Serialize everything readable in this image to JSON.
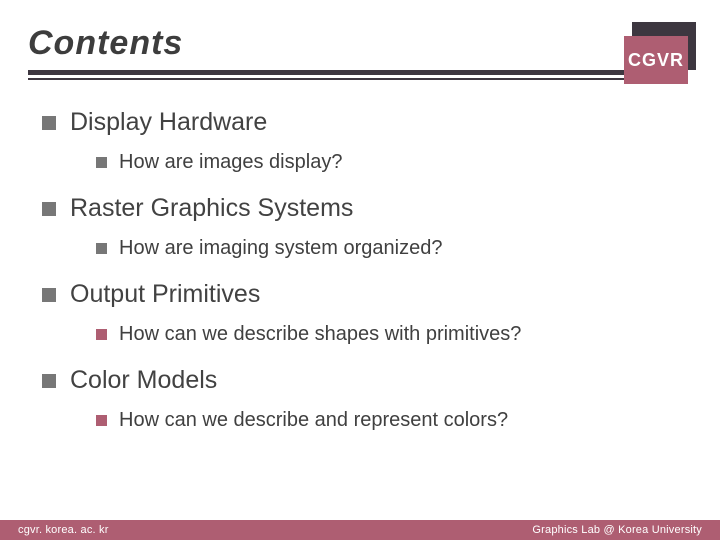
{
  "header": {
    "title": "Contents",
    "badge": "CGVR"
  },
  "items": [
    {
      "title": "Display Hardware",
      "sub": "How are images display?",
      "bullet_color": "#777777"
    },
    {
      "title": "Raster Graphics Systems",
      "sub": "How are imaging system organized?",
      "bullet_color": "#777777"
    },
    {
      "title": "Output Primitives",
      "sub": "How can we describe shapes with primitives?",
      "bullet_color": "#ae5e72"
    },
    {
      "title": "Color Models",
      "sub": "How can we describe and represent colors?",
      "bullet_color": "#ae5e72"
    }
  ],
  "footer": {
    "left": "cgvr. korea. ac. kr",
    "right": "Graphics Lab @ Korea University"
  },
  "colors": {
    "accent": "#ae5e72",
    "dark": "#3d3740",
    "text": "#424242"
  }
}
